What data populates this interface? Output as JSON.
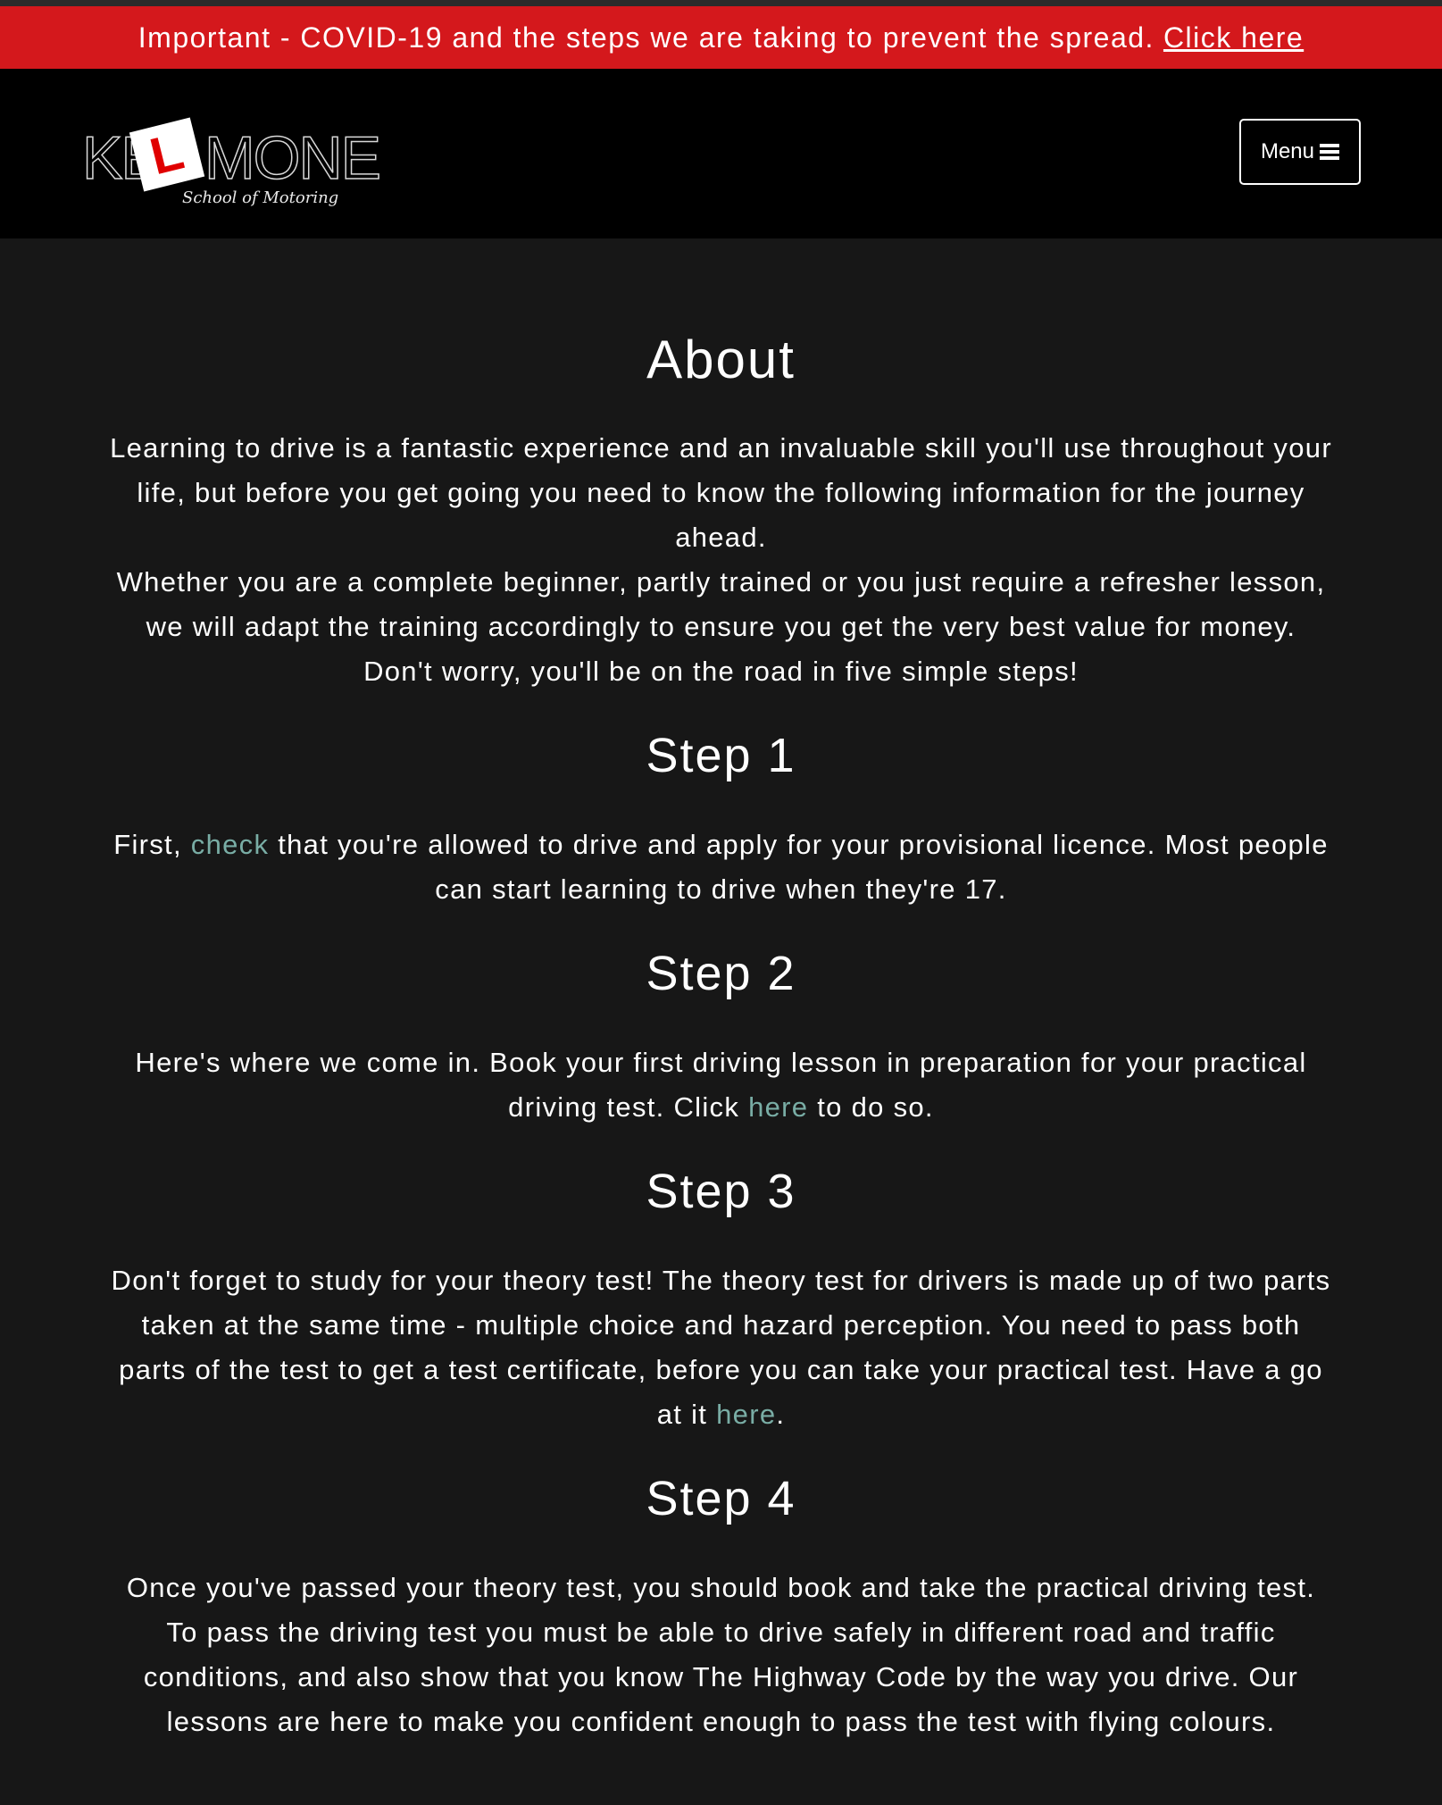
{
  "banner": {
    "message": "Important - COVID-19 and the steps we are taking to prevent the spread.",
    "link": "Click here",
    "background": "#d4181c"
  },
  "header": {
    "logo": {
      "text_left": "KE",
      "plate_letter": "L",
      "text_right": "MONE",
      "tagline": "School of Motoring"
    },
    "menu_label": "Menu",
    "menu_icon": "hamburger-icon"
  },
  "main": {
    "title": "About",
    "intro_1": "Learning to drive is a fantastic experience and an invaluable skill you'll use throughout your life, but before you get going you need to know the following information for the journey ahead.",
    "intro_2": "Whether you are a complete beginner, partly trained or you just require a refresher lesson, we will adapt the training accordingly to ensure you get the very best value for money. Don't worry, you'll be on the road in five simple steps!",
    "link_color": "#79ada5",
    "steps": [
      {
        "heading": "Step 1",
        "before": "First, ",
        "link": "check",
        "after": " that you're allowed to drive and apply for your provisional licence. Most people can start learning to drive when they're 17."
      },
      {
        "heading": "Step 2",
        "before": "Here's where we come in. Book your first driving lesson in preparation for your practical driving test. Click ",
        "link": "here",
        "after": " to do so."
      },
      {
        "heading": "Step 3",
        "before": "Don't forget to study for your theory test! The theory test for drivers is made up of two parts taken at the same time - multiple choice and hazard perception. You need to pass both parts of the test to get a test certificate, before you can take your practical test. Have a go at it ",
        "link": "here",
        "after": "."
      },
      {
        "heading": "Step 4",
        "text": "Once you've passed your theory test, you should book and take the practical driving test. To pass the driving test you must be able to drive safely in different road and traffic conditions, and also show that you know The Highway Code by the way you drive. Our lessons are here to make you confident enough to pass the test with flying colours."
      }
    ]
  }
}
